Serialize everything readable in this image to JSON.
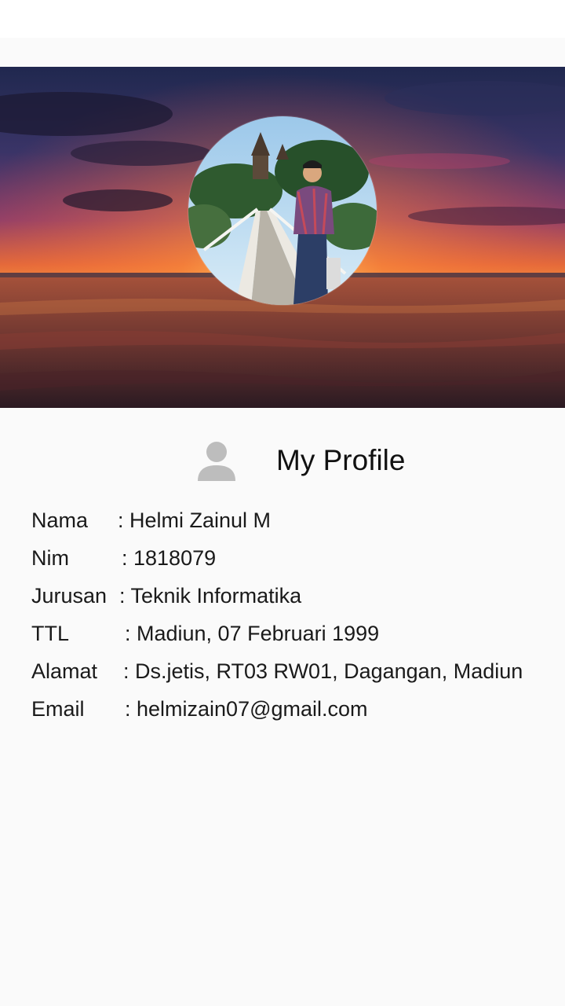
{
  "profile": {
    "title": "My Profile",
    "fields": [
      {
        "label": "Nama",
        "value": ": Helmi Zainul M"
      },
      {
        "label": "Nim",
        "value": ": 1818079"
      },
      {
        "label": "Jurusan",
        "value": ": Teknik Informatika"
      },
      {
        "label": "TTL",
        "value": ": Madiun, 07 Februari 1999"
      },
      {
        "label": "Alamat",
        "value": ": Ds.jetis, RT03 RW01, Dagangan, Madiun"
      },
      {
        "label": "Email",
        "value": ": helmizain07@gmail.com"
      }
    ]
  },
  "icons": {
    "title_icon": "person-icon"
  },
  "colors": {
    "background": "#fafafa",
    "status_bar": "#ffffff",
    "icon_gray": "#bdbdbd",
    "text": "#1a1a1a"
  }
}
